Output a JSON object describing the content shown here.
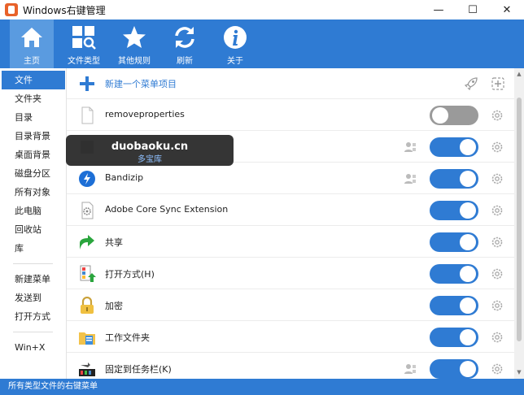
{
  "window": {
    "title": "Windows右键管理",
    "minimize": "—",
    "maximize": "☐",
    "close": "✕"
  },
  "toolbar": {
    "home": "主页",
    "file_types": "文件类型",
    "other_rules": "其他规则",
    "refresh": "刷新",
    "about": "关于"
  },
  "sidebar": {
    "items": [
      "文件",
      "文件夹",
      "目录",
      "目录背景",
      "桌面背景",
      "磁盘分区",
      "所有对象",
      "此电脑",
      "回收站",
      "库"
    ],
    "items2": [
      "新建菜单",
      "发送到",
      "打开方式"
    ],
    "items3": [
      "Win+X"
    ]
  },
  "list": {
    "new_item": "新建一个菜单项目",
    "rows": [
      {
        "label": "removeproperties",
        "enabled": false,
        "person": false
      },
      {
        "label": "",
        "enabled": true,
        "person": true
      },
      {
        "label": "Bandizip",
        "enabled": true,
        "person": true
      },
      {
        "label": "Adobe Core Sync Extension",
        "enabled": true,
        "person": false
      },
      {
        "label": "共享",
        "enabled": true,
        "person": false
      },
      {
        "label": "打开方式(H)",
        "enabled": true,
        "person": false
      },
      {
        "label": "加密",
        "enabled": true,
        "person": false
      },
      {
        "label": "工作文件夹",
        "enabled": true,
        "person": false
      },
      {
        "label": "固定到任务栏(K)",
        "enabled": true,
        "person": true
      }
    ]
  },
  "watermark": {
    "main": "duobaoku.cn",
    "sub": "多宝库"
  },
  "status": {
    "text": "所有类型文件的右键菜单"
  },
  "colors": {
    "accent": "#2f7bd3",
    "toggle_off": "#9a9a9a"
  }
}
